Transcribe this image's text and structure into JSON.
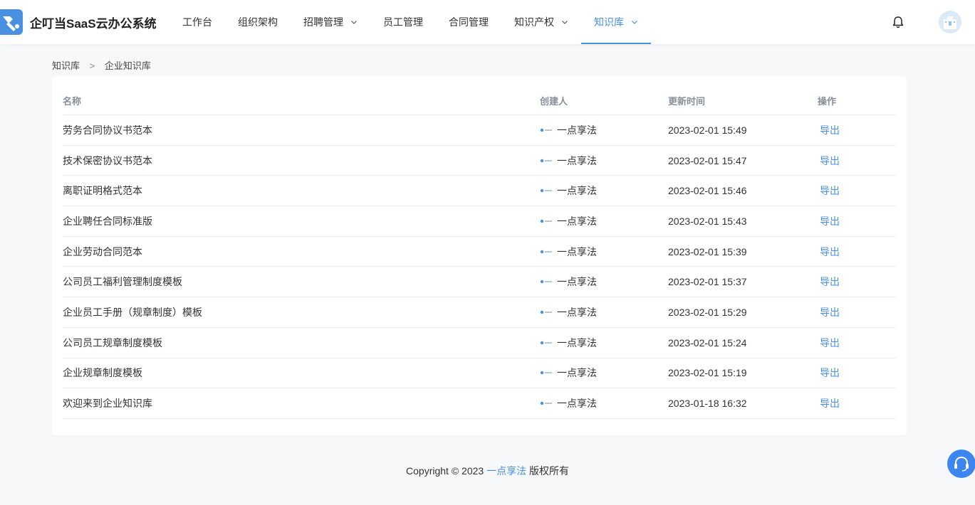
{
  "app": {
    "title": "企叮当SaaS云办公系统"
  },
  "nav": {
    "items": [
      {
        "label": "工作台",
        "dropdown": false,
        "active": false
      },
      {
        "label": "组织架构",
        "dropdown": false,
        "active": false
      },
      {
        "label": "招聘管理",
        "dropdown": true,
        "active": false
      },
      {
        "label": "员工管理",
        "dropdown": false,
        "active": false
      },
      {
        "label": "合同管理",
        "dropdown": false,
        "active": false
      },
      {
        "label": "知识产权",
        "dropdown": true,
        "active": false
      },
      {
        "label": "知识库",
        "dropdown": true,
        "active": true
      }
    ]
  },
  "icons": {
    "logo": "hammer-logo-icon",
    "bell": "bell-icon",
    "avatar": "building-avatar-icon",
    "support": "headset-icon"
  },
  "colors": {
    "accent": "#4a90e2",
    "support": "#3d86f0"
  },
  "breadcrumb": {
    "root": "知识库",
    "separator": ">",
    "current": "企业知识库"
  },
  "table": {
    "headers": {
      "name": "名称",
      "creator": "创建人",
      "updated": "更新时间",
      "action": "操作"
    },
    "rows": [
      {
        "name": "劳务合同协议书范本",
        "creator": "一点享法",
        "updated": "2023-02-01 15:49",
        "action": "导出"
      },
      {
        "name": "技术保密协议书范本",
        "creator": "一点享法",
        "updated": "2023-02-01 15:47",
        "action": "导出"
      },
      {
        "name": "离职证明格式范本",
        "creator": "一点享法",
        "updated": "2023-02-01 15:46",
        "action": "导出"
      },
      {
        "name": "企业聘任合同标准版",
        "creator": "一点享法",
        "updated": "2023-02-01 15:43",
        "action": "导出"
      },
      {
        "name": "企业劳动合同范本",
        "creator": "一点享法",
        "updated": "2023-02-01 15:39",
        "action": "导出"
      },
      {
        "name": "公司员工福利管理制度模板",
        "creator": "一点享法",
        "updated": "2023-02-01 15:37",
        "action": "导出"
      },
      {
        "name": "企业员工手册（规章制度）模板",
        "creator": "一点享法",
        "updated": "2023-02-01 15:29",
        "action": "导出"
      },
      {
        "name": "公司员工规章制度模板",
        "creator": "一点享法",
        "updated": "2023-02-01 15:24",
        "action": "导出"
      },
      {
        "name": "企业规章制度模板",
        "creator": "一点享法",
        "updated": "2023-02-01 15:19",
        "action": "导出"
      },
      {
        "name": "欢迎来到企业知识库",
        "creator": "一点享法",
        "updated": "2023-01-18 16:32",
        "action": "导出"
      }
    ]
  },
  "footer": {
    "prefix": "Copyright © 2023 ",
    "brand": "一点享法",
    "suffix": " 版权所有"
  }
}
